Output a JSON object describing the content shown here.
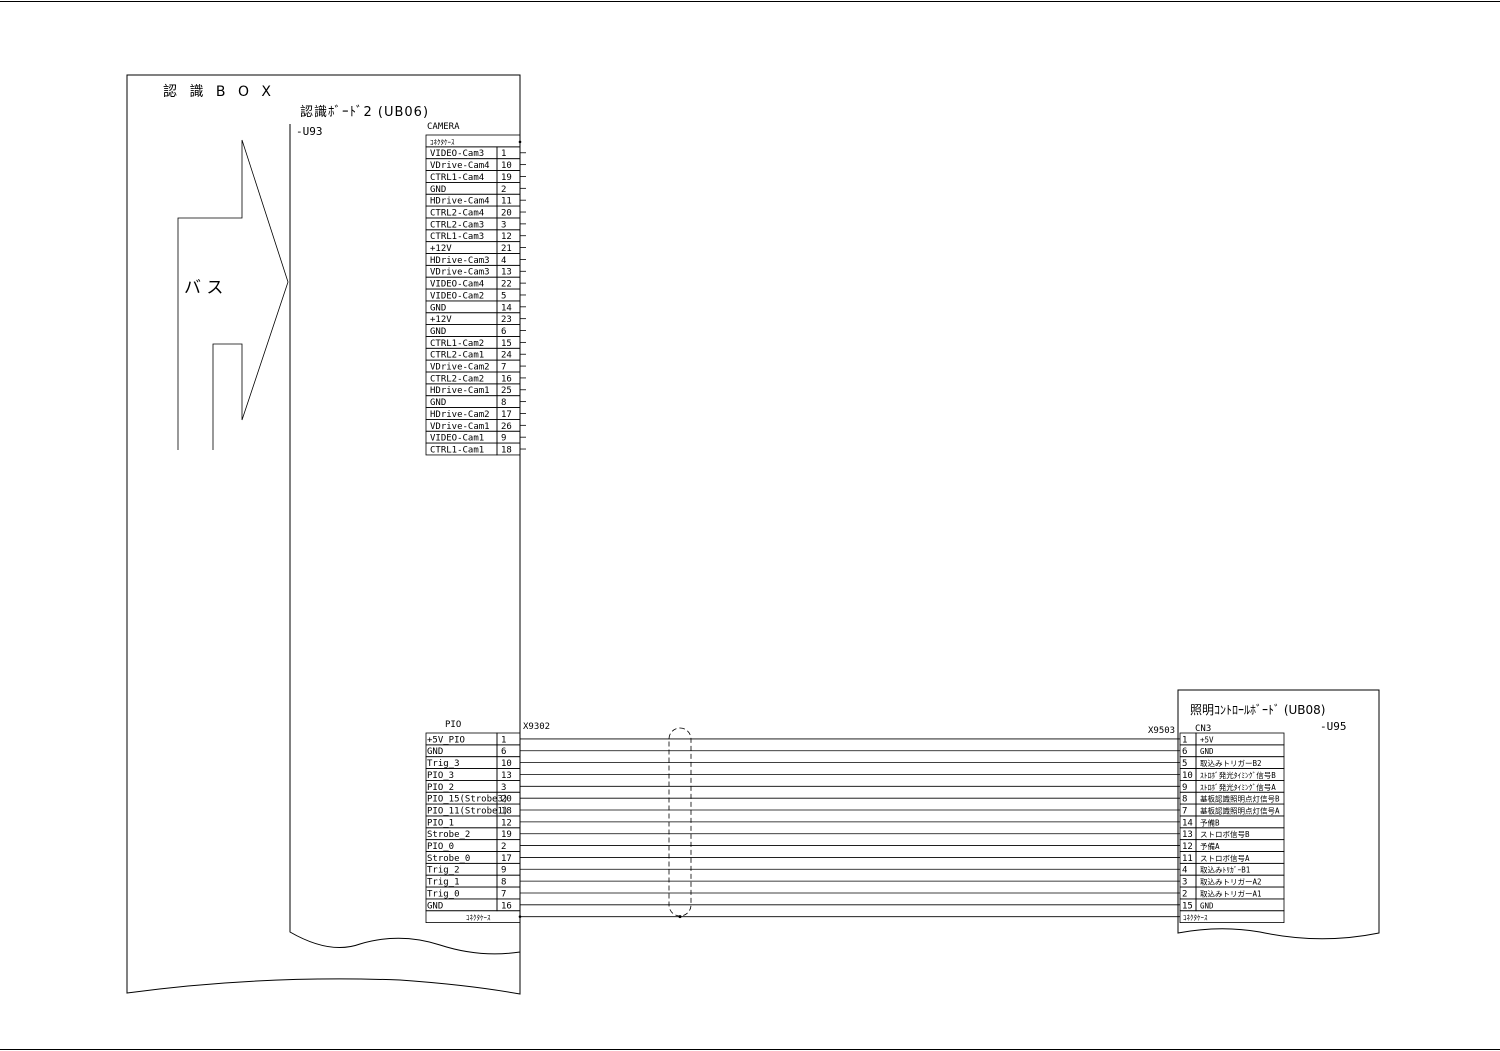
{
  "recognition_box": {
    "title": "認 識 B O X",
    "bus_label": "バ ス"
  },
  "board_ub06": {
    "title": "認識ﾎﾞｰﾄﾞ2 (UB06)",
    "ref": "-U93",
    "camera": {
      "header": "CAMERA",
      "case_label": "ｺﾈｸﾀｹｰｽ",
      "pins": [
        {
          "name": "VIDEO-Cam3",
          "num": "1"
        },
        {
          "name": "VDrive-Cam4",
          "num": "10"
        },
        {
          "name": "CTRL1-Cam4",
          "num": "19"
        },
        {
          "name": "GND",
          "num": "2"
        },
        {
          "name": "HDrive-Cam4",
          "num": "11"
        },
        {
          "name": "CTRL2-Cam4",
          "num": "20"
        },
        {
          "name": "CTRL2-Cam3",
          "num": "3"
        },
        {
          "name": "CTRL1-Cam3",
          "num": "12"
        },
        {
          "name": "+12V",
          "num": "21"
        },
        {
          "name": "HDrive-Cam3",
          "num": "4"
        },
        {
          "name": "VDrive-Cam3",
          "num": "13"
        },
        {
          "name": "VIDEO-Cam4",
          "num": "22"
        },
        {
          "name": "VIDEO-Cam2",
          "num": "5"
        },
        {
          "name": "GND",
          "num": "14"
        },
        {
          "name": "+12V",
          "num": "23"
        },
        {
          "name": "GND",
          "num": "6"
        },
        {
          "name": "CTRL1-Cam2",
          "num": "15"
        },
        {
          "name": "CTRL2-Cam1",
          "num": "24"
        },
        {
          "name": "VDrive-Cam2",
          "num": "7"
        },
        {
          "name": "CTRL2-Cam2",
          "num": "16"
        },
        {
          "name": "HDrive-Cam1",
          "num": "25"
        },
        {
          "name": "GND",
          "num": "8"
        },
        {
          "name": "HDrive-Cam2",
          "num": "17"
        },
        {
          "name": "VDrive-Cam1",
          "num": "26"
        },
        {
          "name": "VIDEO-Cam1",
          "num": "9"
        },
        {
          "name": "CTRL1-Cam1",
          "num": "18"
        }
      ]
    },
    "pio": {
      "header": "PIO",
      "connector": "X9302",
      "case_label": "ｺﾈｸﾀｹｰｽ",
      "pins": [
        {
          "name": "+5V_PIO",
          "num": "1"
        },
        {
          "name": "GND",
          "num": "6"
        },
        {
          "name": "Trig_3",
          "num": "10"
        },
        {
          "name": "PIO_3",
          "num": "13"
        },
        {
          "name": "PIO_2",
          "num": "3"
        },
        {
          "name": "PIO_15(Strobe3)",
          "num": "20"
        },
        {
          "name": "PIO_11(Strobe1)",
          "num": "18"
        },
        {
          "name": "PIO_1",
          "num": "12"
        },
        {
          "name": "Strobe_2",
          "num": "19"
        },
        {
          "name": "PIO_0",
          "num": "2"
        },
        {
          "name": "Strobe_0",
          "num": "17"
        },
        {
          "name": "Trig_2",
          "num": "9"
        },
        {
          "name": "Trig_1",
          "num": "8"
        },
        {
          "name": "Trig_0",
          "num": "7"
        },
        {
          "name": "GND",
          "num": "16"
        }
      ]
    }
  },
  "board_ub08": {
    "title": "照明ｺﾝﾄﾛｰﾙﾎﾞｰﾄﾞ (UB08)",
    "ref": "-U95",
    "connector": "X9503",
    "cn_label": "CN3",
    "case_label": "ｺﾈｸﾀｹｰｽ",
    "pins": [
      {
        "num": "1",
        "name": "+5V"
      },
      {
        "num": "6",
        "name": "GND"
      },
      {
        "num": "5",
        "name": "取込みトリガーB2"
      },
      {
        "num": "10",
        "name": "ｽﾄﾛﾎﾞ発光ﾀｲﾐﾝｸﾞ信号B"
      },
      {
        "num": "9",
        "name": "ｽﾄﾛﾎﾞ発光ﾀｲﾐﾝｸﾞ信号A"
      },
      {
        "num": "8",
        "name": "基板認識照明点灯信号B"
      },
      {
        "num": "7",
        "name": "基板認識照明点灯信号A"
      },
      {
        "num": "14",
        "name": "予備B"
      },
      {
        "num": "13",
        "name": "ストロボ信号B"
      },
      {
        "num": "12",
        "name": "予備A"
      },
      {
        "num": "11",
        "name": "ストロボ信号A"
      },
      {
        "num": "4",
        "name": "取込みﾄﾘｶﾞｰB1"
      },
      {
        "num": "3",
        "name": "取込みトリガーA2"
      },
      {
        "num": "2",
        "name": "取込みトリガーA1"
      },
      {
        "num": "15",
        "name": "GND"
      }
    ]
  }
}
